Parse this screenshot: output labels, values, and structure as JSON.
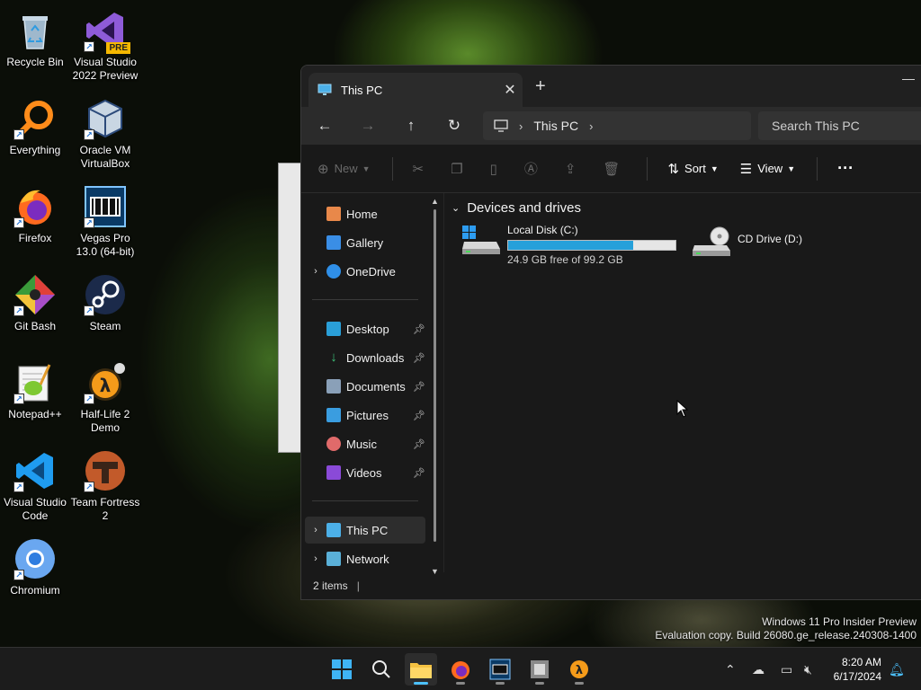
{
  "desktop": {
    "icons": [
      {
        "label": "Recycle Bin",
        "icon": "recycle-bin-icon"
      },
      {
        "label": "Visual Studio 2022 Preview",
        "icon": "visual-studio-icon",
        "badge": "PRE"
      },
      {
        "label": "Everything",
        "icon": "everything-icon"
      },
      {
        "label": "Oracle VM VirtualBox",
        "icon": "virtualbox-icon"
      },
      {
        "label": "Firefox",
        "icon": "firefox-icon"
      },
      {
        "label": "Vegas Pro 13.0 (64-bit)",
        "icon": "vegas-pro-icon"
      },
      {
        "label": "Git Bash",
        "icon": "git-bash-icon"
      },
      {
        "label": "Steam",
        "icon": "steam-icon"
      },
      {
        "label": "Notepad++",
        "icon": "notepad-plus-plus-icon"
      },
      {
        "label": "Half-Life 2 Demo",
        "icon": "half-life-2-icon"
      },
      {
        "label": "Visual Studio Code",
        "icon": "vscode-icon"
      },
      {
        "label": "Team Fortress 2",
        "icon": "team-fortress-2-icon"
      },
      {
        "label": "Chromium",
        "icon": "chromium-icon"
      }
    ]
  },
  "explorer": {
    "tab_title": "This PC",
    "address": {
      "segments": [
        "This PC"
      ]
    },
    "search_placeholder": "Search This PC",
    "toolbar": {
      "new_label": "New",
      "sort_label": "Sort",
      "view_label": "View"
    },
    "sidebar": {
      "items": [
        {
          "label": "Home",
          "icon": "home-icon"
        },
        {
          "label": "Gallery",
          "icon": "gallery-icon"
        },
        {
          "label": "OneDrive",
          "icon": "onedrive-icon"
        },
        {
          "label": "Desktop",
          "icon": "desktop-folder-icon"
        },
        {
          "label": "Downloads",
          "icon": "downloads-icon"
        },
        {
          "label": "Documents",
          "icon": "documents-icon"
        },
        {
          "label": "Pictures",
          "icon": "pictures-icon"
        },
        {
          "label": "Music",
          "icon": "music-icon"
        },
        {
          "label": "Videos",
          "icon": "videos-icon"
        },
        {
          "label": "This PC",
          "icon": "this-pc-icon"
        },
        {
          "label": "Network",
          "icon": "network-icon"
        }
      ]
    },
    "content": {
      "group_title": "Devices and drives",
      "drives": [
        {
          "name": "Local Disk (C:)",
          "free_text": "24.9 GB free of 99.2 GB",
          "used_fraction": 0.749
        },
        {
          "name": "CD Drive (D:)"
        }
      ]
    },
    "status": "2 items"
  },
  "watermark": {
    "line1": "Windows 11 Pro Insider Preview",
    "line2": "Evaluation copy. Build 26080.ge_release.240308-1400"
  },
  "taskbar": {
    "clock_time": "8:20 AM",
    "clock_date": "6/17/2024"
  },
  "colors": {
    "accent": "#4cc2ff",
    "capacity_fill": "#26a0da"
  }
}
